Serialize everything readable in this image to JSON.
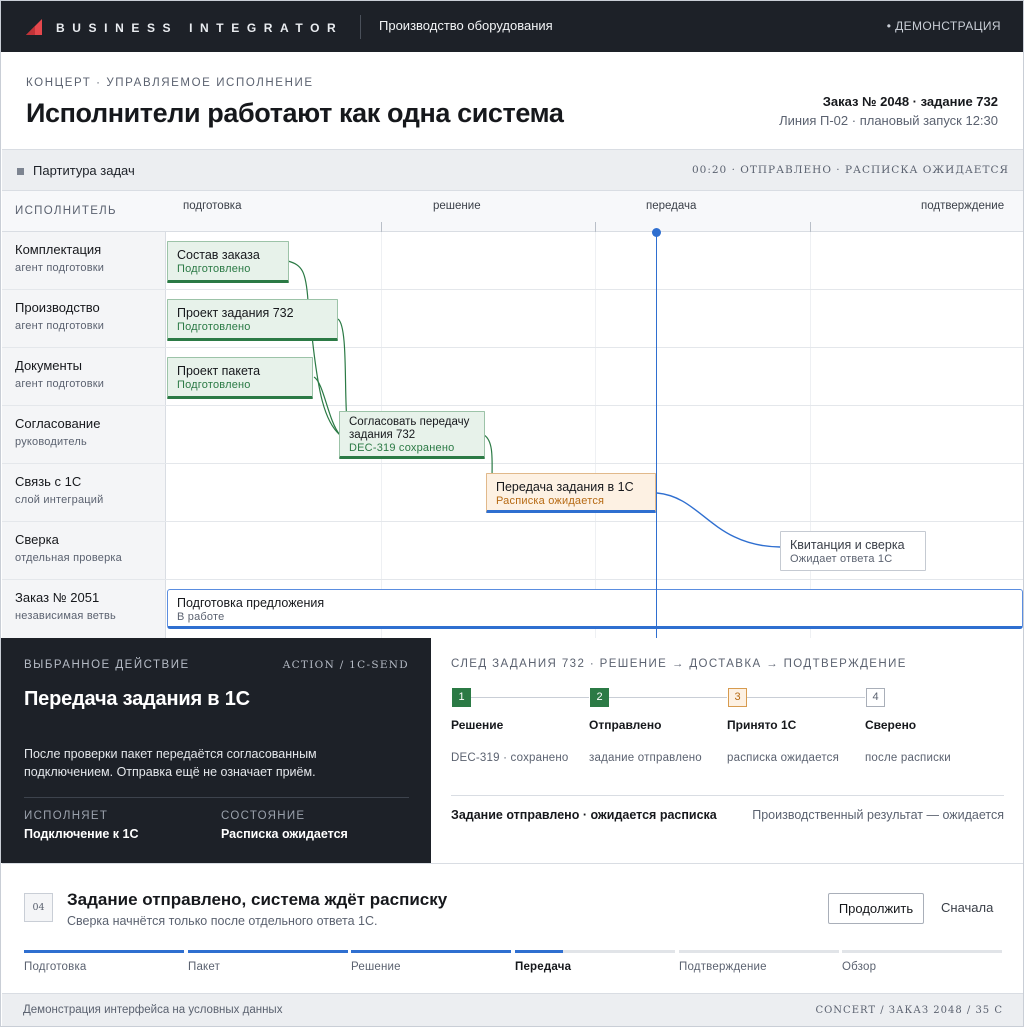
{
  "topbar": {
    "brand": "BUSINESS INTEGRATOR",
    "company": "Производство оборудования",
    "demo": "• ДЕМОНСТРАЦИЯ",
    "accent": "#e5484d"
  },
  "header": {
    "eyebrow": "КОНЦЕРТ · УПРАВЛЯЕМОЕ ИСПОЛНЕНИЕ",
    "title": "Исполнители работают как одна система",
    "order": "Заказ № 2048 · задание 732",
    "line": "Линия П-02 · плановый запуск 12:30"
  },
  "score": {
    "title": "Партитура задач",
    "status": "00:20 · ОТПРАВЛЕНО · РАСПИСКА ОЖИДАЕТСЯ",
    "actor_header": "ИСПОЛНИТЕЛЬ",
    "phases": [
      "подготовка",
      "решение",
      "передача",
      "подтверждение"
    ],
    "actors": [
      {
        "name": "Комплектация",
        "role": "агент подготовки"
      },
      {
        "name": "Производство",
        "role": "агент подготовки"
      },
      {
        "name": "Документы",
        "role": "агент подготовки"
      },
      {
        "name": "Согласование",
        "role": "руководитель"
      },
      {
        "name": "Связь с 1С",
        "role": "слой интеграций"
      },
      {
        "name": "Сверка",
        "role": "отдельная проверка"
      },
      {
        "name": "Заказ № 2051",
        "role": "независимая ветвь"
      }
    ],
    "tasks": [
      {
        "title": "Состав заказа",
        "status": "Подготовлено",
        "state": "done"
      },
      {
        "title": "Проект задания 732",
        "status": "Подготовлено",
        "state": "done"
      },
      {
        "title": "Проект пакета",
        "status": "Подготовлено",
        "state": "done"
      },
      {
        "title": "Согласовать передачу задания 732",
        "status": "DEC-319 сохранено",
        "state": "done"
      },
      {
        "title": "Передача задания в 1С",
        "status": "Расписка ожидается",
        "state": "active"
      },
      {
        "title": "Квитанция и сверка",
        "status": "Ожидает ответа 1С",
        "state": "pending"
      },
      {
        "title": "Подготовка предложения",
        "status": "В работе",
        "state": "branch"
      }
    ],
    "colors": {
      "done": "#2b7a45",
      "active": "#2f6fd0",
      "warn": "#b66a14"
    }
  },
  "action": {
    "eyebrow": "ВЫБРАННОЕ ДЕЙСТВИЕ",
    "code": "ACTION / 1C-SEND",
    "title": "Передача задания в 1С",
    "description": "После проверки пакет передаётся согласованным подключением. Отправка ещё не означает приём.",
    "executor_label": "ИСПОЛНЯЕТ",
    "executor": "Подключение к 1С",
    "state_label": "СОСТОЯНИЕ",
    "state": "Расписка ожидается"
  },
  "trace": {
    "title": "СЛЕД ЗАДАНИЯ 732 · РЕШЕНИЕ → ДОСТАВКА → ПОДТВЕРЖДЕНИЕ",
    "steps": [
      {
        "num": "1",
        "name": "Решение",
        "note": "DEC-319 · сохранено",
        "state": "ok"
      },
      {
        "num": "2",
        "name": "Отправлено",
        "note": "задание отправлено",
        "state": "ok"
      },
      {
        "num": "3",
        "name": "Принято 1С",
        "note": "расписка ожидается",
        "state": "warn"
      },
      {
        "num": "4",
        "name": "Сверено",
        "note": "после расписки",
        "state": "todo"
      }
    ],
    "summary": "Задание отправлено · ожидается расписка",
    "result": "Производственный результат — ожидается"
  },
  "stepbar": {
    "num": "04",
    "title": "Задание отправлено, система ждёт расписку",
    "subtitle": "Сверка начнётся только после отдельного ответа 1С.",
    "continue": "Продолжить",
    "restart": "Сначала",
    "stages": [
      {
        "label": "Подготовка",
        "progress": 1.0
      },
      {
        "label": "Пакет",
        "progress": 1.0
      },
      {
        "label": "Решение",
        "progress": 1.0
      },
      {
        "label": "Передача",
        "progress": 0.3,
        "current": true
      },
      {
        "label": "Подтверждение",
        "progress": 0
      },
      {
        "label": "Обзор",
        "progress": 0
      }
    ]
  },
  "footer": {
    "left": "Демонстрация интерфейса на условных данных",
    "right": "CONCERT / ЗАКАЗ 2048 / 35 С"
  }
}
